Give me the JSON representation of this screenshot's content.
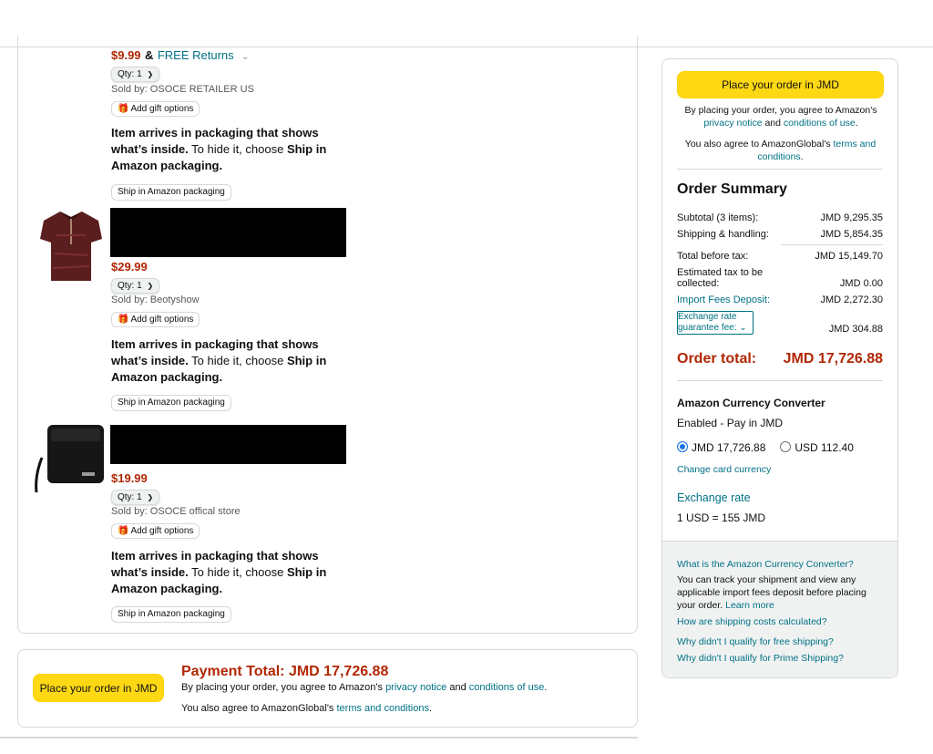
{
  "items": [
    {
      "price": "$9.99",
      "amp": "&",
      "free_returns": "FREE Returns",
      "qty_label": "Qty:",
      "qty_value": "1",
      "sold_by": "Sold by: OSOCE RETAILER US",
      "gift_label": "Add gift options",
      "pkg_bold1": "Item arrives in packaging that shows what’s inside.",
      "pkg_plain": " To hide it, choose ",
      "pkg_bold2": "Ship in Amazon packaging.",
      "ship_btn": "Ship in Amazon packaging"
    },
    {
      "price": "$29.99",
      "qty_label": "Qty:",
      "qty_value": "1",
      "sold_by": "Sold by: Beotyshow",
      "gift_label": "Add gift options",
      "pkg_bold1": "Item arrives in packaging that shows what’s inside.",
      "pkg_plain": " To hide it, choose ",
      "pkg_bold2": "Ship in Amazon packaging.",
      "ship_btn": "Ship in Amazon packaging"
    },
    {
      "price": "$19.99",
      "qty_label": "Qty:",
      "qty_value": "1",
      "sold_by": "Sold by: OSOCE offical store",
      "gift_label": "Add gift options",
      "pkg_bold1": "Item arrives in packaging that shows what’s inside.",
      "pkg_plain": " To hide it, choose ",
      "pkg_bold2": "Ship in Amazon packaging.",
      "ship_btn": "Ship in Amazon packaging"
    }
  ],
  "payment": {
    "button": "Place your order in JMD",
    "title": "Payment Total: JMD 17,726.88",
    "line1_pre": "By placing your order, you agree to Amazon's ",
    "privacy": "privacy notice",
    "and": " and ",
    "conditions": "conditions of use",
    "dot": ".",
    "line2_pre": "You also agree to AmazonGlobal's ",
    "terms": "terms and conditions",
    "dot2": "."
  },
  "side": {
    "button": "Place your order in JMD",
    "agree_pre": "By placing your order, you agree to Amazon's",
    "privacy": "privacy notice",
    "and": " and ",
    "conditions": "conditions of use",
    "dot": ".",
    "global_pre": "You also agree to AmazonGlobal's ",
    "terms": "terms and conditions",
    "dot2": ".",
    "summary_title": "Order Summary",
    "rows": [
      {
        "label": "Subtotal (3 items):",
        "value": "JMD 9,295.35"
      },
      {
        "label": "Shipping & handling:",
        "value": "JMD 5,854.35"
      },
      {
        "label": "Total before tax:",
        "value": "JMD 15,149.70"
      },
      {
        "label": "Estimated tax to be collected:",
        "value": "JMD 0.00"
      },
      {
        "label": "Import Fees Deposit:",
        "value": "JMD 2,272.30"
      },
      {
        "label": "Exchange rate guarantee fee:",
        "value": "JMD 304.88"
      }
    ],
    "order_total_label": "Order total:",
    "order_total_value": "JMD 17,726.88",
    "converter_title": "Amazon Currency Converter",
    "converter_status": "Enabled - Pay in JMD",
    "option_jmd": "JMD 17,726.88",
    "option_usd": "USD 112.40",
    "change_currency": "Change card currency",
    "exchange_title": "Exchange rate",
    "exchange_value": "1 USD = 155 JMD",
    "what_is": "What is the Amazon Currency Converter?",
    "track_text": "You can track your shipment and view any applicable import fees deposit before placing your order.",
    "learn_more": "Learn more",
    "shipping_calc": "How are shipping costs calculated?",
    "free_ship": "Why didn't I qualify for free shipping?",
    "prime_ship": "Why didn't I qualify for Prime Shipping?"
  }
}
